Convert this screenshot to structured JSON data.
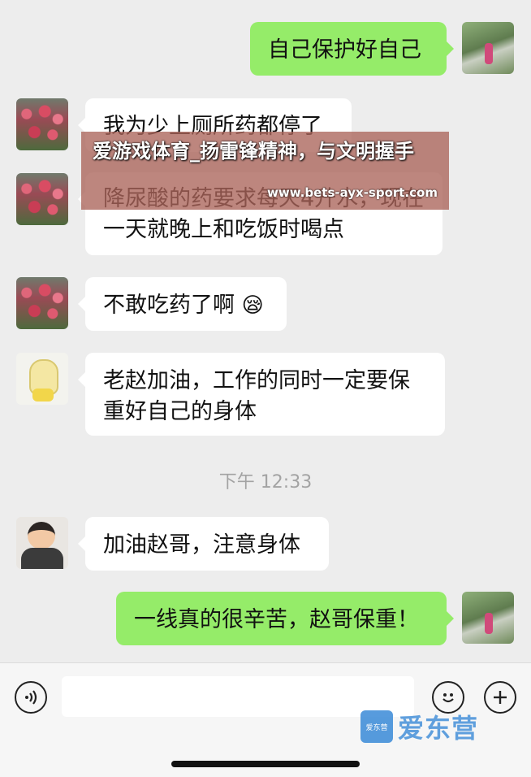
{
  "messages": [
    {
      "side": "right",
      "avatar": "scenic-path-avatar",
      "text": "自己保护好自己"
    },
    {
      "side": "left",
      "avatar": "flower-garden-avatar",
      "text": "我为少上厕所药都停了"
    },
    {
      "side": "left",
      "avatar": "flower-garden-avatar",
      "text": "降尿酸的药要求每天4升水，现在一天就晚上和吃饭时喝点"
    },
    {
      "side": "left",
      "avatar": "flower-garden-avatar",
      "text": "不敢吃药了啊",
      "emoji": "😪"
    },
    {
      "side": "left",
      "avatar": "cartoon-avatar",
      "text": "老赵加油，工作的同时一定要保重好自己的身体"
    },
    {
      "side": "left",
      "avatar": "kid-avatar",
      "text": "加油赵哥，注意身体"
    },
    {
      "side": "right",
      "avatar": "scenic-path-avatar",
      "text": "一线真的很辛苦，赵哥保重！"
    }
  ],
  "timestamp": "下午 12:33",
  "watermark": {
    "title": "爱游戏体育_扬雷锋精神，与文明握手",
    "url": "www.bets-ayx-sport.com"
  },
  "input_bar": {
    "voice_icon": "voice-icon",
    "emoji_icon": "emoji-icon",
    "plus_icon": "plus-icon"
  },
  "logo": {
    "badge": "爱东营",
    "text": "爱东营"
  }
}
